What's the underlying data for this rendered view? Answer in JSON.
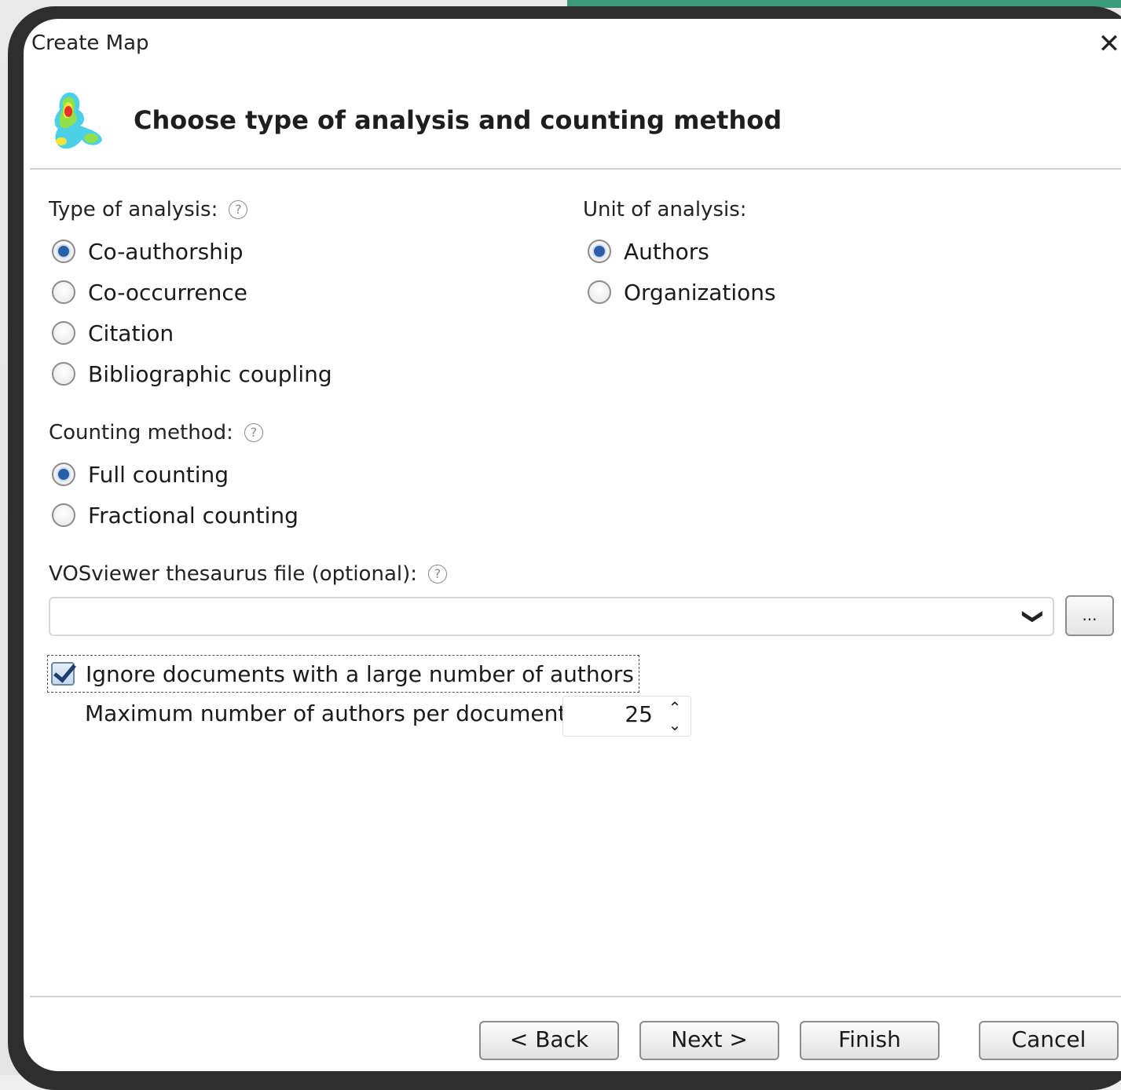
{
  "window": {
    "title": "Create Map",
    "close_glyph": "✕"
  },
  "header": {
    "title": "Choose type of analysis and counting method",
    "logo_icon": "vosviewer-density-icon"
  },
  "type_of_analysis": {
    "label": "Type of analysis:",
    "help": "?",
    "options": [
      {
        "label": "Co-authorship",
        "checked": true
      },
      {
        "label": "Co-occurrence",
        "checked": false
      },
      {
        "label": "Citation",
        "checked": false
      },
      {
        "label": "Bibliographic coupling",
        "checked": false
      }
    ]
  },
  "unit_of_analysis": {
    "label": "Unit of analysis:",
    "options": [
      {
        "label": "Authors",
        "checked": true
      },
      {
        "label": "Organizations",
        "checked": false
      }
    ]
  },
  "counting_method": {
    "label": "Counting method:",
    "help": "?",
    "options": [
      {
        "label": "Full counting",
        "checked": true
      },
      {
        "label": "Fractional counting",
        "checked": false
      }
    ]
  },
  "thesaurus": {
    "label": "VOSviewer thesaurus file (optional):",
    "help": "?",
    "value": "",
    "chevron": "❯",
    "browse_label": "..."
  },
  "ignore_large": {
    "label": "Ignore documents with a large number of authors",
    "checked": true
  },
  "max_authors": {
    "label": "Maximum number of authors per document:",
    "value": "25",
    "up": "⌃",
    "down": "⌄"
  },
  "buttons": {
    "back": "< Back",
    "next": "Next >",
    "finish": "Finish",
    "cancel": "Cancel"
  },
  "colors": {
    "radio_selected": "#2a5fa8",
    "backdrop_teal": "#3a9a7a"
  }
}
